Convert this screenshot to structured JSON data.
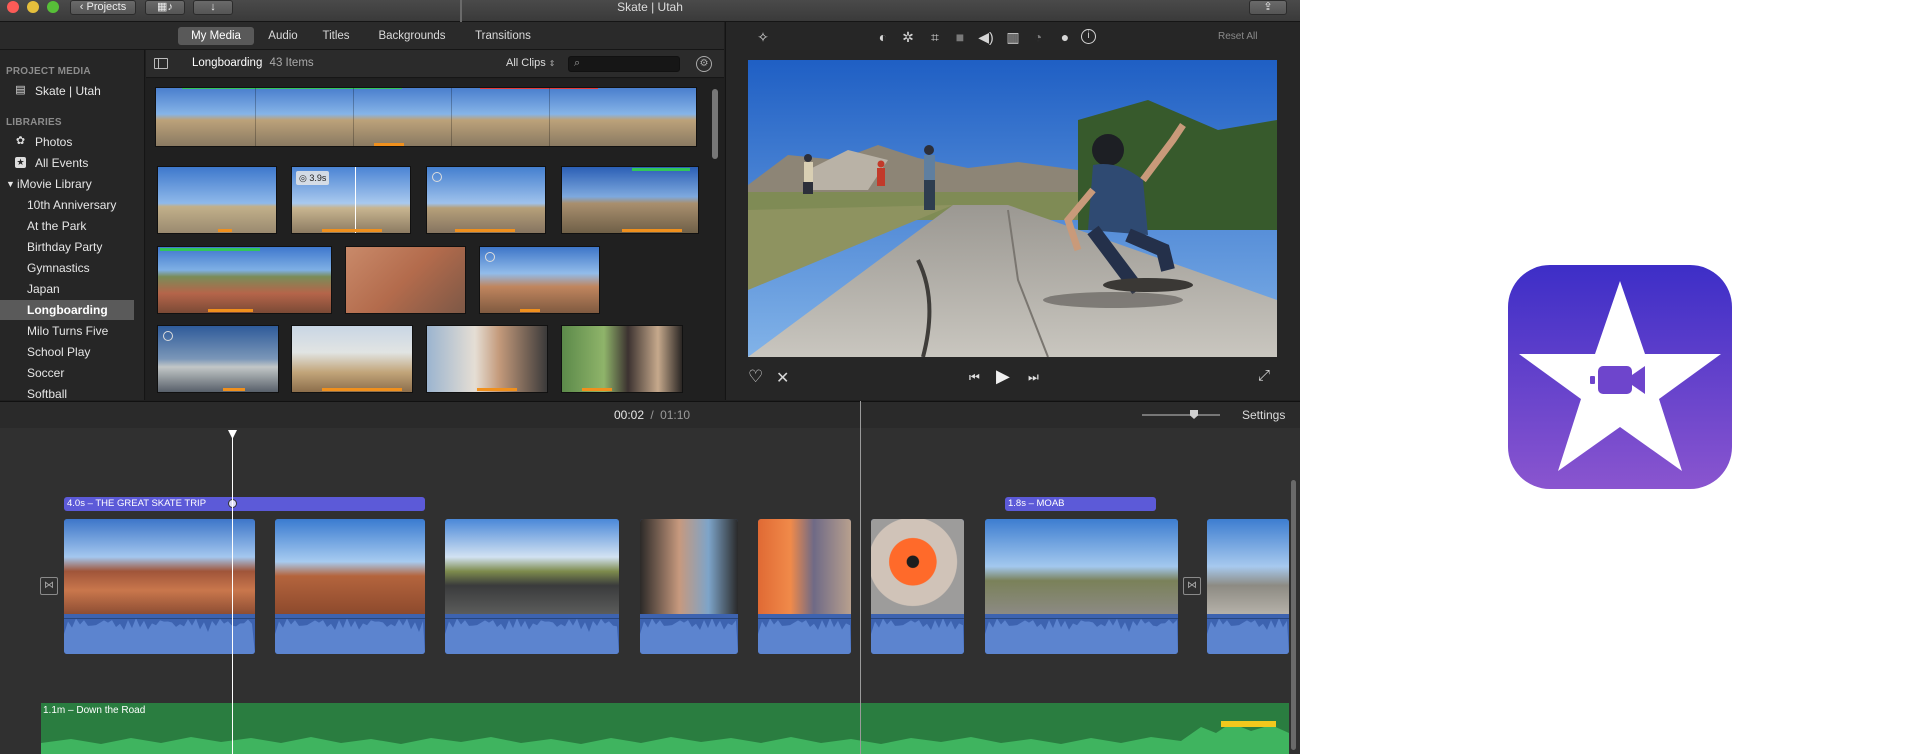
{
  "titlebar": {
    "projects_label": "Projects",
    "window_title": "Skate | Utah"
  },
  "browser": {
    "tabs": [
      {
        "label": "My Media",
        "active": true
      },
      {
        "label": "Audio",
        "active": false
      },
      {
        "label": "Titles",
        "active": false
      },
      {
        "label": "Backgrounds",
        "active": false
      },
      {
        "label": "Transitions",
        "active": false
      }
    ],
    "event_name": "Longboarding",
    "item_count": "43 Items",
    "filter_label": "All Clips",
    "search_placeholder": "",
    "clip_duration_badge": "3.9s"
  },
  "sidebar": {
    "project_media_header": "PROJECT MEDIA",
    "project_item": "Skate | Utah",
    "libraries_header": "LIBRARIES",
    "photos": "Photos",
    "all_events": "All Events",
    "library_name": "iMovie Library",
    "events": [
      {
        "label": "10th Anniversary",
        "selected": false
      },
      {
        "label": "At the Park",
        "selected": false
      },
      {
        "label": "Birthday Party",
        "selected": false
      },
      {
        "label": "Gymnastics",
        "selected": false
      },
      {
        "label": "Japan",
        "selected": false
      },
      {
        "label": "Longboarding",
        "selected": true
      },
      {
        "label": "Milo Turns Five",
        "selected": false
      },
      {
        "label": "School Play",
        "selected": false
      },
      {
        "label": "Soccer",
        "selected": false
      },
      {
        "label": "Softball",
        "selected": false
      }
    ]
  },
  "viewer": {
    "reset_all": "Reset All"
  },
  "timeline": {
    "current_time": "00:02",
    "separator": "/",
    "total_time": "01:10",
    "settings_label": "Settings",
    "title_1": "4.0s – THE GREAT SKATE TRIP",
    "title_2": "1.8s – MOAB",
    "music_track": "1.1m – Down the Road"
  },
  "colors": {
    "accent_purple": "#5c5ad8",
    "audio_blue": "#3d63b0",
    "music_green": "#2f9a4d",
    "favorite_green": "#31c55a",
    "reject_red": "#e53b3b",
    "analysis_orange": "#f0901d"
  },
  "icons": [
    "magic-wand-icon",
    "color-balance-icon",
    "color-palette-icon",
    "crop-icon",
    "stabilization-icon",
    "volume-icon",
    "equalizer-icon",
    "speed-icon",
    "filter-icon",
    "info-icon",
    "heart-icon",
    "reject-icon",
    "skip-back-icon",
    "play-icon",
    "skip-forward-icon",
    "fullscreen-icon",
    "share-icon",
    "imovie-app-icon"
  ]
}
